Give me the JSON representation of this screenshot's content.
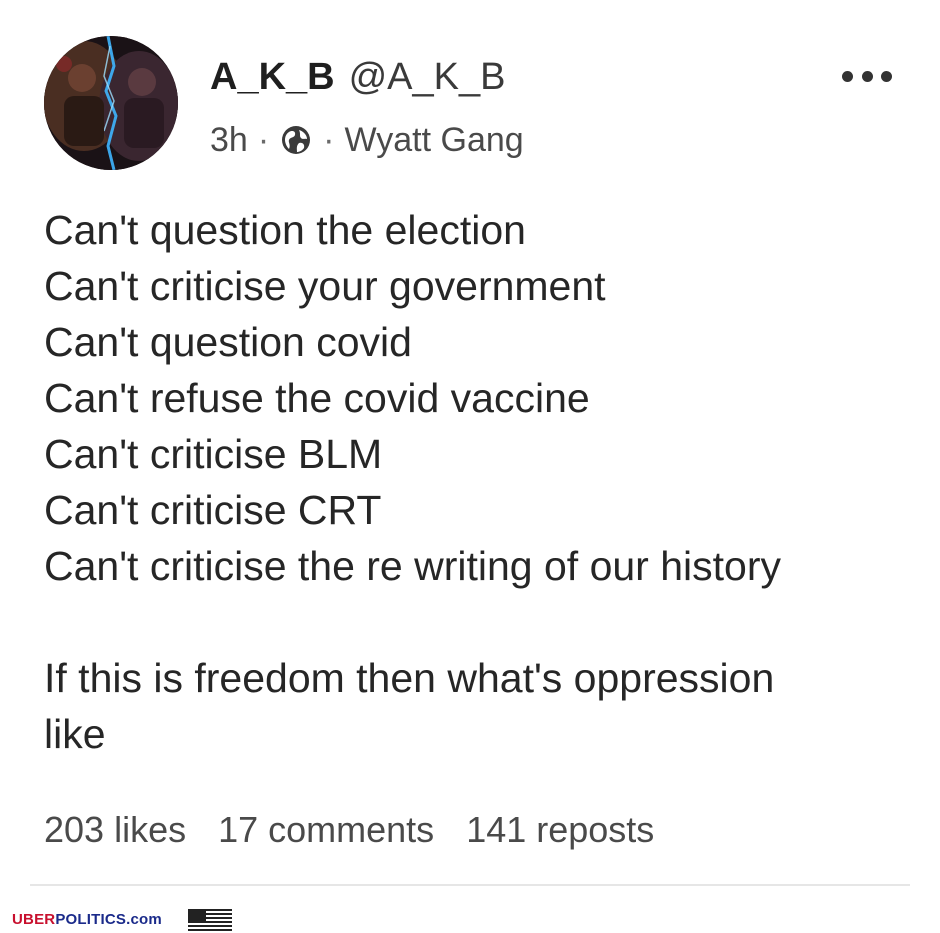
{
  "post": {
    "author_name": "A_K_B",
    "author_handle": "@A_K_B",
    "time": "3h",
    "separator": "·",
    "audience_icon": "globe-icon",
    "community": "Wyatt Gang",
    "more_icon": "more-horizontal-icon",
    "avatar_icon": "profile-avatar",
    "lines": [
      "Can't question the election",
      "Can't criticise your government",
      "Can't question covid",
      "Can't refuse the covid vaccine",
      "Can't criticise BLM",
      "Can't criticise CRT",
      "Can't criticise the re writing of our history"
    ],
    "closing_lines": [
      "If this is freedom then what's oppression",
      "like"
    ],
    "stats": {
      "likes": "203 likes",
      "comments": "17 comments",
      "reposts": "141 reposts"
    }
  },
  "watermark": {
    "part1": "UBER",
    "part2": "POLITICS",
    "part3": ".com",
    "flag_icon": "us-flag-icon"
  },
  "colors": {
    "text": "#262626",
    "secondary": "#4a4a4a",
    "brand_red": "#c8102e",
    "brand_blue": "#1a2a8a"
  }
}
